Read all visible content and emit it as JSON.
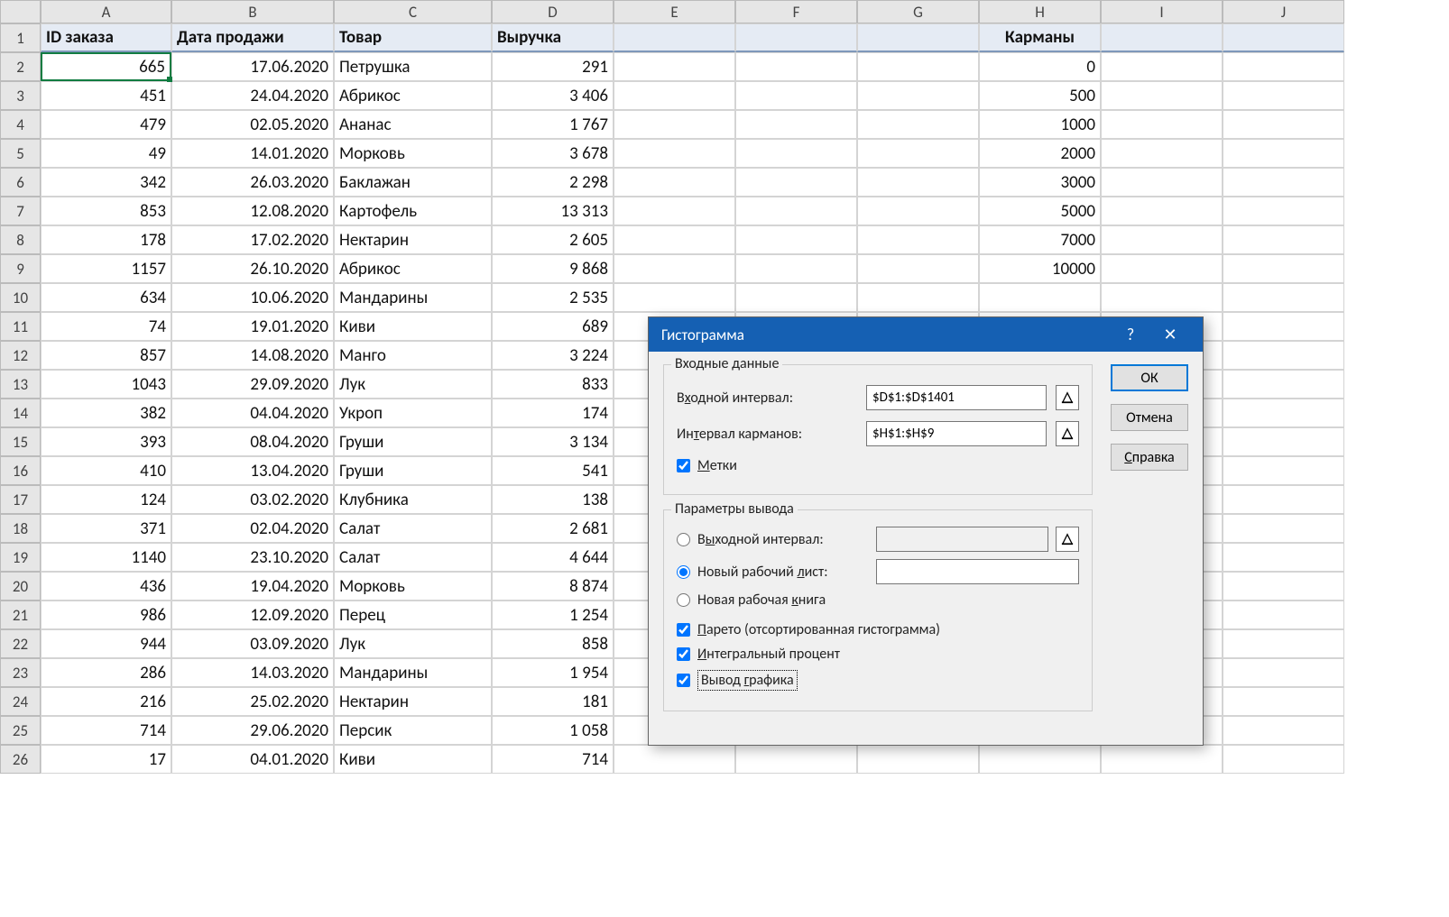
{
  "columns": [
    "A",
    "B",
    "C",
    "D",
    "E",
    "F",
    "G",
    "H",
    "I",
    "J"
  ],
  "rowCount": 26,
  "headers": {
    "A": "ID заказа",
    "B": "Дата продажи",
    "C": "Товар",
    "D": "Выручка",
    "H": "Карманы"
  },
  "rows": [
    {
      "A": "665",
      "B": "17.06.2020",
      "C": "Петрушка",
      "D": "291",
      "H": "0"
    },
    {
      "A": "451",
      "B": "24.04.2020",
      "C": "Абрикос",
      "D": "3 406",
      "H": "500"
    },
    {
      "A": "479",
      "B": "02.05.2020",
      "C": "Ананас",
      "D": "1 767",
      "H": "1000"
    },
    {
      "A": "49",
      "B": "14.01.2020",
      "C": "Морковь",
      "D": "3 678",
      "H": "2000"
    },
    {
      "A": "342",
      "B": "26.03.2020",
      "C": "Баклажан",
      "D": "2 298",
      "H": "3000"
    },
    {
      "A": "853",
      "B": "12.08.2020",
      "C": "Картофель",
      "D": "13 313",
      "H": "5000"
    },
    {
      "A": "178",
      "B": "17.02.2020",
      "C": "Нектарин",
      "D": "2 605",
      "H": "7000"
    },
    {
      "A": "1157",
      "B": "26.10.2020",
      "C": "Абрикос",
      "D": "9 868",
      "H": "10000"
    },
    {
      "A": "634",
      "B": "10.06.2020",
      "C": "Мандарины",
      "D": "2 535"
    },
    {
      "A": "74",
      "B": "19.01.2020",
      "C": "Киви",
      "D": "689"
    },
    {
      "A": "857",
      "B": "14.08.2020",
      "C": "Манго",
      "D": "3 224"
    },
    {
      "A": "1043",
      "B": "29.09.2020",
      "C": "Лук",
      "D": "833"
    },
    {
      "A": "382",
      "B": "04.04.2020",
      "C": "Укроп",
      "D": "174"
    },
    {
      "A": "393",
      "B": "08.04.2020",
      "C": "Груши",
      "D": "3 134"
    },
    {
      "A": "410",
      "B": "13.04.2020",
      "C": "Груши",
      "D": "541"
    },
    {
      "A": "124",
      "B": "03.02.2020",
      "C": "Клубника",
      "D": "138"
    },
    {
      "A": "371",
      "B": "02.04.2020",
      "C": "Салат",
      "D": "2 681"
    },
    {
      "A": "1140",
      "B": "23.10.2020",
      "C": "Салат",
      "D": "4 644"
    },
    {
      "A": "436",
      "B": "19.04.2020",
      "C": "Морковь",
      "D": "8 874"
    },
    {
      "A": "986",
      "B": "12.09.2020",
      "C": "Перец",
      "D": "1 254"
    },
    {
      "A": "944",
      "B": "03.09.2020",
      "C": "Лук",
      "D": "858"
    },
    {
      "A": "286",
      "B": "14.03.2020",
      "C": "Мандарины",
      "D": "1 954"
    },
    {
      "A": "216",
      "B": "25.02.2020",
      "C": "Нектарин",
      "D": "181"
    },
    {
      "A": "714",
      "B": "29.06.2020",
      "C": "Персик",
      "D": "1 058"
    },
    {
      "A": "17",
      "B": "04.01.2020",
      "C": "Киви",
      "D": "714"
    }
  ],
  "dialog": {
    "title": "Гистограмма",
    "group1": "Входные данные",
    "input_label": "Входной интервал:",
    "input_value": "$D$1:$D$1401",
    "bins_label": "Интервал карманов:",
    "bins_value": "$H$1:$H$9",
    "labels_chk": "Метки",
    "group2": "Параметры вывода",
    "out_range": "Выходной интервал:",
    "new_sheet": "Новый рабочий лист:",
    "new_book": "Новая рабочая книга",
    "pareto": "Парето (отсортированная гистограмма)",
    "cumulative": "Интегральный процент",
    "chart_out": "Вывод графика",
    "ok": "ОК",
    "cancel": "Отмена",
    "help": "Справка"
  }
}
